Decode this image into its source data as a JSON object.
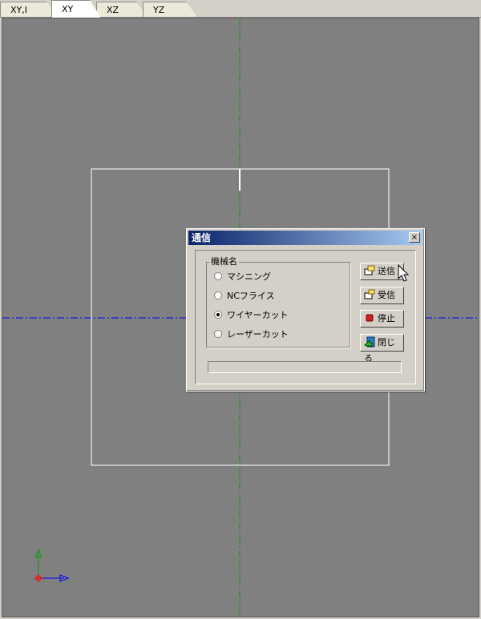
{
  "tabs": [
    {
      "label": "XY,I",
      "active": false
    },
    {
      "label": "XY",
      "active": true
    },
    {
      "label": "XZ",
      "active": false
    },
    {
      "label": "YZ",
      "active": false
    }
  ],
  "dialog": {
    "title": "通信",
    "close_label": "×",
    "group_label": "機械名",
    "radios": [
      {
        "label": "マシニング",
        "checked": false
      },
      {
        "label": "NCフライス",
        "checked": false
      },
      {
        "label": "ワイヤーカット",
        "checked": true
      },
      {
        "label": "レーザーカット",
        "checked": false
      }
    ],
    "buttons": {
      "send": "送信",
      "receive": "受信",
      "stop": "停止",
      "close": "閉じる"
    },
    "progress_value": 0
  },
  "colors": {
    "viewport_bg": "#808080",
    "titlebar_start": "#0a246a",
    "titlebar_end": "#a6caf0",
    "axis_x": "#0000ff",
    "axis_y": "#008000",
    "origin": "#ff0000"
  }
}
